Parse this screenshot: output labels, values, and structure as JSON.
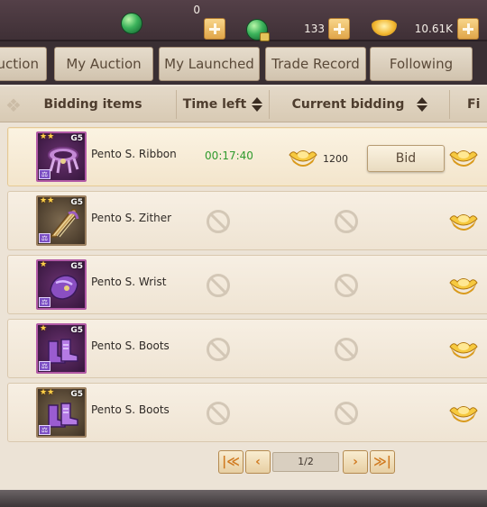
{
  "currencies": [
    {
      "icon": "jade-icon",
      "value": "0"
    },
    {
      "icon": "locked-jade-icon",
      "value": "133"
    },
    {
      "icon": "gold-ingot-icon",
      "value": "10.61K"
    }
  ],
  "tabs": [
    "uction",
    "My Auction",
    "My Launched",
    "Trade Record",
    "Following"
  ],
  "columns": {
    "items": "Bidding items",
    "time": "Time left",
    "current": "Current bidding",
    "fixed": "Fi"
  },
  "rows": [
    {
      "name": "Pento S. Ribbon",
      "grade": "G5",
      "stars": "★★",
      "time": "00:17:40",
      "bid": "1200",
      "bid_label": "Bid",
      "icon": "ribbon-icon"
    },
    {
      "name": "Pento S. Zither",
      "grade": "G5",
      "stars": "★★",
      "icon": "zither-icon"
    },
    {
      "name": "Pento S. Wrist",
      "grade": "G5",
      "stars": "★",
      "icon": "wrist-guard-icon"
    },
    {
      "name": "Pento S. Boots",
      "grade": "G5",
      "stars": "★",
      "icon": "boots-icon"
    },
    {
      "name": "Pento S. Boots",
      "grade": "G5",
      "stars": "★★",
      "icon": "boots-icon"
    }
  ],
  "pager": {
    "first": "|≪",
    "prev": "‹",
    "info": "1/2",
    "next": "›",
    "last": "≫|"
  },
  "colors": {
    "timer": "#2f9a2d",
    "accent": "#e0a548",
    "gold": "#f2b731"
  }
}
